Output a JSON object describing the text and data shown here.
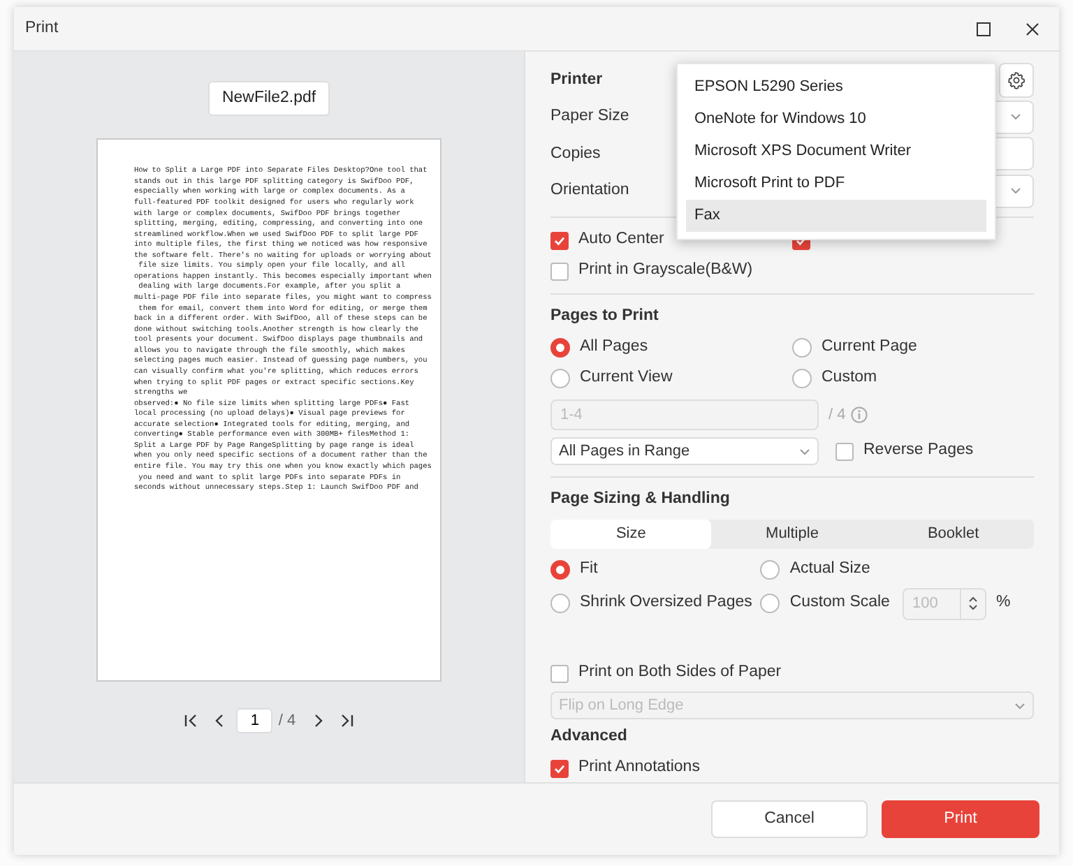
{
  "window": {
    "title": "Print"
  },
  "preview": {
    "file_name": "NewFile2.pdf",
    "page_lines": [
      "How to Split a Large PDF into Separate Files Desktop?One tool that",
      "stands out in this large PDF splitting category is SwifDoo PDF,",
      "especially when working with large or complex documents. As a",
      "full-featured PDF toolkit designed for users who regularly work",
      "with large or complex documents, SwifDoo PDF brings together",
      "splitting, merging, editing, compressing, and converting into one",
      "streamlined workflow.When we used SwifDoo PDF to split large PDF",
      "into multiple files, the first thing we noticed was how responsive",
      "the software felt. There's no waiting for uploads or worrying about",
      " file size limits. You simply open your file locally, and all",
      "operations happen instantly. This becomes especially important when",
      " dealing with large documents.For example, after you split a",
      "multi-page PDF file into separate files, you might want to compress",
      " them for email, convert them into Word for editing, or merge them",
      "back in a different order. With SwifDoo, all of these steps can be",
      "done without switching tools.Another strength is how clearly the",
      "tool presents your document. SwifDoo displays page thumbnails and",
      "allows you to navigate through the file smoothly, which makes",
      "selecting pages much easier. Instead of guessing page numbers, you",
      "can visually confirm what you're splitting, which reduces errors",
      "when trying to split PDF pages or extract specific sections.Key",
      "strengths we",
      "observed:● No file size limits when splitting large PDFs● Fast",
      "local processing (no upload delays)● Visual page previews for",
      "accurate selection● Integrated tools for editing, merging, and",
      "converting● Stable performance even with 300MB+ filesMethod 1:",
      "Split a Large PDF by Page RangeSplitting by page range is ideal",
      "when you only need specific sections of a document rather than the",
      "entire file. You may try this one when you know exactly which pages",
      " you need and want to split large PDFs into separate PDFs in",
      "seconds without unnecessary steps.Step 1: Launch SwifDoo PDF and"
    ],
    "page_input": "1",
    "page_total": "/ 4"
  },
  "settings": {
    "fields": [
      {
        "label": "Printer",
        "kind": "printer"
      },
      {
        "label": "Paper Size",
        "kind": "select"
      },
      {
        "label": "Copies",
        "kind": "number"
      },
      {
        "label": "Orientation",
        "kind": "select"
      }
    ],
    "options": [
      {
        "label": "Auto Center",
        "checked": true
      },
      {
        "checked": true
      },
      {
        "label": "Print in Grayscale(B&W)",
        "checked": false
      }
    ],
    "pages_to_print": {
      "title": "Pages to Print",
      "choices": [
        {
          "label": "All Pages",
          "selected": true
        },
        {
          "label": "Current Page",
          "selected": false
        },
        {
          "label": "Current View",
          "selected": false
        },
        {
          "label": "Custom",
          "selected": false
        }
      ],
      "range": {
        "value": "1-4",
        "disabled": true
      },
      "range_total": "/ 4",
      "subset": "All Pages in Range",
      "reverse": {
        "label": "Reverse Pages",
        "checked": false
      }
    },
    "sizing": {
      "title": "Page Sizing & Handling",
      "tabs": [
        {
          "label": "Size",
          "selected": true
        },
        {
          "label": "Multiple",
          "selected": false
        },
        {
          "label": "Booklet",
          "selected": false
        }
      ],
      "choices": [
        {
          "label": "Fit",
          "selected": true
        },
        {
          "label": "Actual Size",
          "selected": false
        },
        {
          "label": "Shrink Oversized Pages",
          "selected": false
        },
        {
          "label": "Custom Scale",
          "selected": false
        }
      ],
      "scale": {
        "value": "100",
        "disabled": true
      },
      "scale_unit": "%"
    },
    "duplex": {
      "label": "Print on Both Sides of Paper",
      "checked": false,
      "mode": "Flip on Long Edge",
      "mode_disabled": true
    },
    "advanced": {
      "title": "Advanced",
      "annotations": {
        "label": "Print Annotations",
        "checked": true
      }
    }
  },
  "printer_menu": {
    "items": [
      {
        "label": "EPSON L5290 Series",
        "selected": false
      },
      {
        "label": "OneNote for Windows 10",
        "selected": false
      },
      {
        "label": "Microsoft XPS Document Writer",
        "selected": false
      },
      {
        "label": "Microsoft Print to PDF",
        "selected": false
      },
      {
        "label": "Fax",
        "selected": true
      }
    ]
  },
  "buttons": [
    {
      "label": "Cancel",
      "kind": "secondary"
    },
    {
      "label": "Print",
      "kind": "primary"
    }
  ]
}
